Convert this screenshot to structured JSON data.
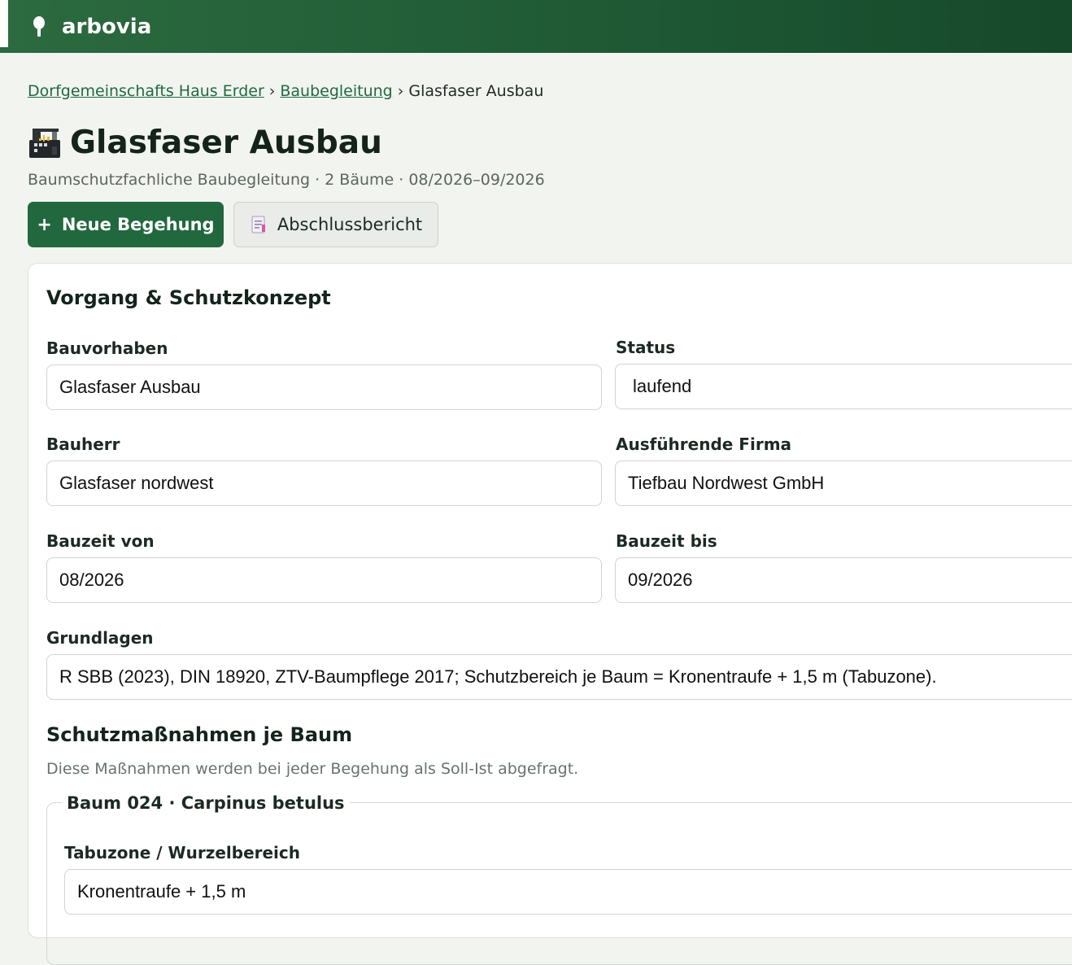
{
  "app": {
    "name": "arbovia",
    "logo_icon": "tree-icon"
  },
  "breadcrumb": {
    "items": [
      "Dorfgemeinschafts Haus Erder",
      "Baubegleitung"
    ],
    "current": "Glasfaser Ausbau",
    "separator": "›"
  },
  "page": {
    "icon": "construction-icon",
    "title": "Glasfaser Ausbau",
    "subtitle": "Baumschutzfachliche Baubegleitung · 2 Bäume · 08/2026–09/2026"
  },
  "actions": {
    "primary_plus": "+",
    "primary_label": "Neue Begehung",
    "secondary_icon": "document-icon",
    "secondary_label": "Abschlussbericht"
  },
  "form": {
    "section_title": "Vorgang & Schutzkonzept",
    "bauvorhaben": {
      "label": "Bauvorhaben",
      "value": "Glasfaser Ausbau"
    },
    "status": {
      "label": "Status",
      "value": "laufend"
    },
    "bauherr": {
      "label": "Bauherr",
      "value": "Glasfaser nordwest"
    },
    "firma": {
      "label": "Ausführende Firma",
      "value": "Tiefbau Nordwest GmbH"
    },
    "bauzeit_von": {
      "label": "Bauzeit von",
      "value": "08/2026"
    },
    "bauzeit_bis": {
      "label": "Bauzeit bis",
      "value": "09/2026"
    },
    "grundlagen": {
      "label": "Grundlagen",
      "value": "R SBB (2023), DIN 18920, ZTV-Baumpflege 2017; Schutzbereich je Baum = Kronentraufe + 1,5 m (Tabuzone)."
    }
  },
  "schutz": {
    "section_title": "Schutzmaßnahmen je Baum",
    "hint": "Diese Maßnahmen werden bei jeder Begehung als Soll-Ist abgefragt.",
    "trees": [
      {
        "legend": "Baum 024 · Carpinus betulus",
        "tabuzone": {
          "label": "Tabuzone / Wurzelbereich",
          "value": "Kronentraufe + 1,5 m"
        }
      }
    ]
  },
  "colors": {
    "header_start": "#2c6a3f",
    "header_end": "#16482a",
    "primary": "#22683e",
    "link": "#1f6b3e",
    "background": "#f2f4f0"
  }
}
